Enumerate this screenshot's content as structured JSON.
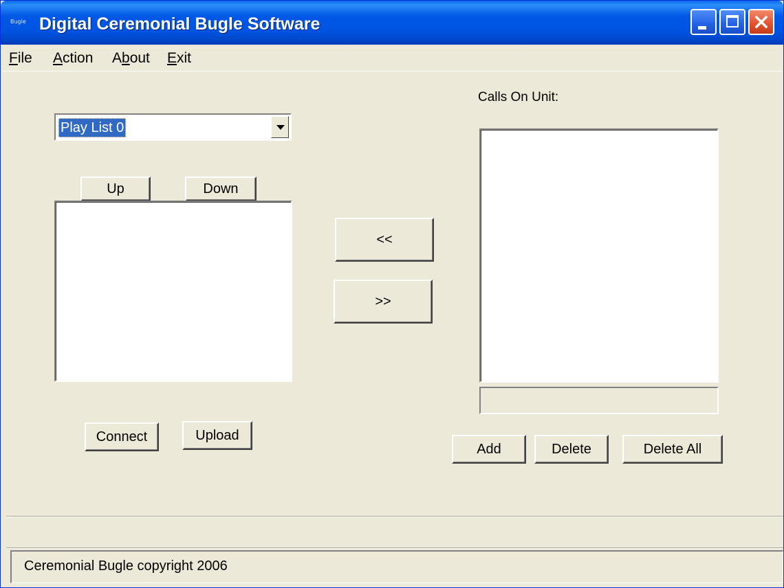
{
  "window": {
    "app_icon_text": "Bugle",
    "title": "Digital Ceremonial Bugle Software",
    "minimize_icon": "minimize-icon",
    "maximize_icon": "maximize-icon",
    "close_icon": "close-icon"
  },
  "menu": {
    "items": [
      {
        "label": "File",
        "mnemonic_index": 0
      },
      {
        "label": "Action",
        "mnemonic_index": 0
      },
      {
        "label": "About",
        "mnemonic_index": 1
      },
      {
        "label": "Exit",
        "mnemonic_index": 0
      }
    ]
  },
  "left": {
    "playlist_select": {
      "value": "Play List 0"
    },
    "up_label": "Up",
    "down_label": "Down",
    "playlist_items": [],
    "connect_label": "Connect",
    "upload_label": "Upload"
  },
  "middle": {
    "move_left_label": "<<",
    "move_right_label": ">>"
  },
  "right": {
    "calls_label": "Calls On Unit:",
    "calls_items": [],
    "call_name_value": "",
    "add_label": "Add",
    "delete_label": "Delete",
    "delete_all_label": "Delete All"
  },
  "status": {
    "text": "Ceremonial Bugle copyright 2006"
  }
}
